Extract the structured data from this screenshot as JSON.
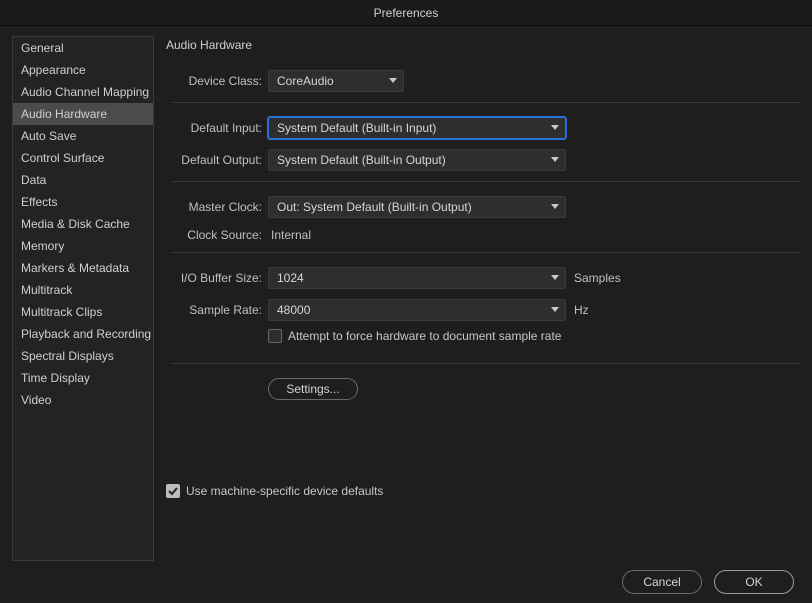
{
  "window": {
    "title": "Preferences"
  },
  "sidebar": {
    "items": [
      {
        "label": "General"
      },
      {
        "label": "Appearance"
      },
      {
        "label": "Audio Channel Mapping"
      },
      {
        "label": "Audio Hardware",
        "selected": true
      },
      {
        "label": "Auto Save"
      },
      {
        "label": "Control Surface"
      },
      {
        "label": "Data"
      },
      {
        "label": "Effects"
      },
      {
        "label": "Media & Disk Cache"
      },
      {
        "label": "Memory"
      },
      {
        "label": "Markers & Metadata"
      },
      {
        "label": "Multitrack"
      },
      {
        "label": "Multitrack Clips"
      },
      {
        "label": "Playback and Recording"
      },
      {
        "label": "Spectral Displays"
      },
      {
        "label": "Time Display"
      },
      {
        "label": "Video"
      }
    ]
  },
  "panel": {
    "title": "Audio Hardware",
    "labels": {
      "device_class": "Device Class:",
      "default_input": "Default Input:",
      "default_output": "Default Output:",
      "master_clock": "Master Clock:",
      "clock_source": "Clock Source:",
      "io_buffer": "I/O Buffer Size:",
      "sample_rate": "Sample Rate:"
    },
    "values": {
      "device_class": "CoreAudio",
      "default_input": "System Default (Built-in Input)",
      "default_output": "System Default (Built-in Output)",
      "master_clock": "Out: System Default (Built-in Output)",
      "clock_source": "Internal",
      "io_buffer": "1024",
      "sample_rate": "48000"
    },
    "suffix": {
      "io_buffer": "Samples",
      "sample_rate": "Hz"
    },
    "checkboxes": {
      "force_hw": {
        "label": "Attempt to force hardware to document sample rate",
        "checked": false
      },
      "machine_defaults": {
        "label": "Use machine-specific device defaults",
        "checked": true
      }
    },
    "buttons": {
      "settings": "Settings..."
    }
  },
  "footer": {
    "cancel": "Cancel",
    "ok": "OK"
  }
}
